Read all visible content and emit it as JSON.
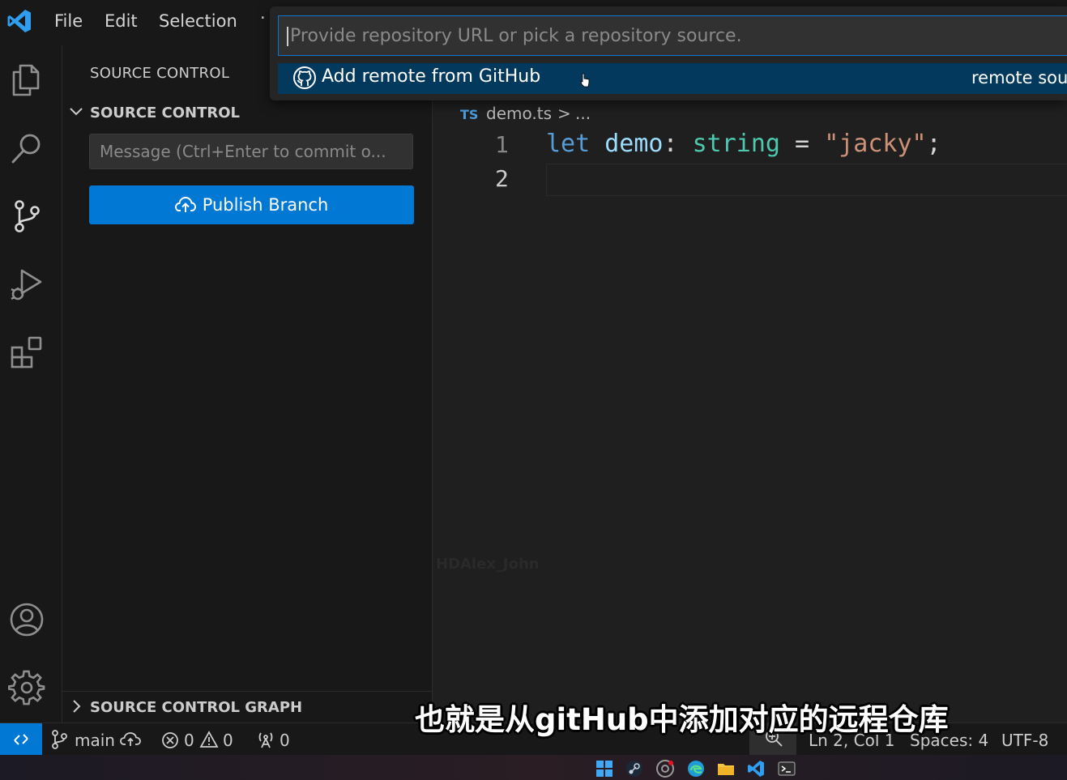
{
  "menubar": {
    "items": [
      "File",
      "Edit",
      "Selection",
      "·"
    ]
  },
  "quick_pick": {
    "placeholder": "Provide repository URL or pick a repository source.",
    "item_label": "Add remote from GitHub",
    "item_detail": "remote sou"
  },
  "activity_bar": {
    "icons": [
      "explorer-icon",
      "search-icon",
      "source-control-icon",
      "run-debug-icon",
      "extensions-icon",
      "accounts-icon",
      "settings-gear-icon"
    ]
  },
  "sidebar": {
    "title": "SOURCE CONTROL",
    "section": "SOURCE CONTROL",
    "commit_placeholder": "Message (Ctrl+Enter to commit o...",
    "publish_label": "Publish Branch",
    "graph_label": "SOURCE CONTROL GRAPH"
  },
  "editor": {
    "breadcrumb": {
      "lang": "TS",
      "file": "demo.ts",
      "sep": ">",
      "more": "..."
    },
    "line_numbers": [
      "1",
      "2"
    ],
    "code": {
      "kw": "let",
      "var": "demo",
      "colon": ": ",
      "type": "string",
      "eq": " = ",
      "str": "\"jacky\"",
      "semi": ";"
    },
    "watermark": "HDAlex_John"
  },
  "statusbar": {
    "branch": "main",
    "errors": "0",
    "warnings": "0",
    "ports": "0",
    "position": "Ln 2, Col 1",
    "spaces": "Spaces: 4",
    "encoding": "UTF-8"
  },
  "subtitle": "也就是从gitHub中添加对应的远程仓库",
  "colors": {
    "accent": "#0078d4",
    "selection": "#04395e",
    "keyword": "#569cd6",
    "variable": "#9cdcfe",
    "type": "#4ec9b0",
    "string": "#ce9178"
  },
  "taskbar": {
    "icons": [
      "windows-start-icon",
      "steam-icon",
      "chrome-icon",
      "edge-icon",
      "file-explorer-icon",
      "vscode-icon",
      "terminal-icon"
    ]
  }
}
